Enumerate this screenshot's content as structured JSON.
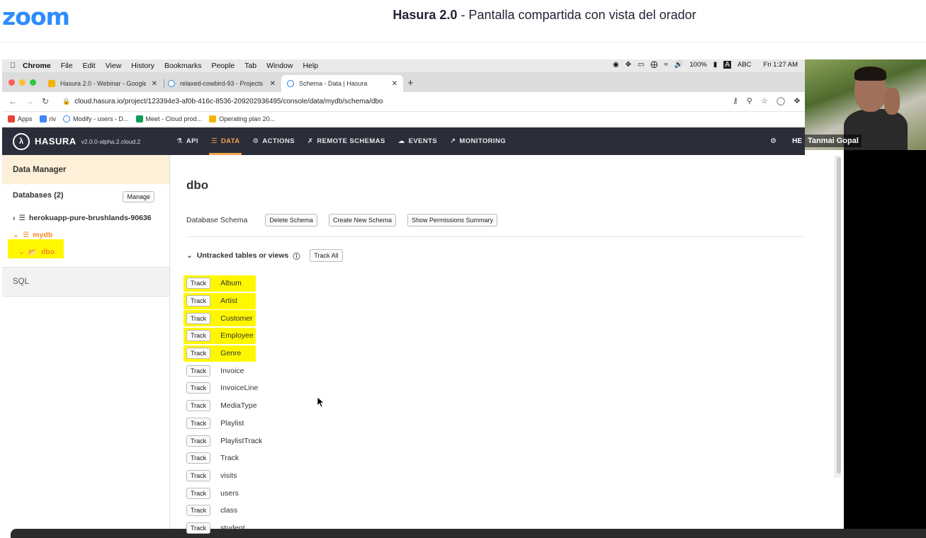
{
  "zoom": {
    "logo": "zoom",
    "title_bold": "Hasura 2.0",
    "title_rest": " - Pantalla compartida con vista del orador"
  },
  "mac": {
    "menu": [
      "Chrome",
      "File",
      "Edit",
      "View",
      "History",
      "Bookmarks",
      "People",
      "Tab",
      "Window",
      "Help"
    ],
    "battery": "100%",
    "input": "ABC",
    "clock": "Fri 1:27 AM"
  },
  "tabs": [
    {
      "title": "Hasura 2.0 - Webinar - Google",
      "favicon_color": "#f4b400"
    },
    {
      "title": "relaxed-cowbird-93 - Projects",
      "favicon_color": "#1e88e5"
    },
    {
      "title": "Schema - Data | Hasura",
      "favicon_color": "#1e88e5",
      "active": true
    }
  ],
  "address": {
    "url": "cloud.hasura.io/project/123394e3-af0b-416c-8536-209202936495/console/data/mydb/schema/dbo"
  },
  "bookmarks": [
    {
      "label": "Apps",
      "color": "#e94235"
    },
    {
      "label": "riv",
      "color": "#4285f4"
    },
    {
      "label": "Modify - users - D...",
      "color": "#1e88e5"
    },
    {
      "label": "Meet - Cloud prod...",
      "color": "#0f9d58"
    },
    {
      "label": "Operating plan 20...",
      "color": "#f4b400"
    }
  ],
  "hasura": {
    "brand": "HASURA",
    "version": "v2.0.0-alpha.2.cloud.2",
    "nav": [
      {
        "label": "API",
        "icon": "flask-icon"
      },
      {
        "label": "DATA",
        "icon": "database-icon",
        "active": true
      },
      {
        "label": "ACTIONS",
        "icon": "gears-icon"
      },
      {
        "label": "REMOTE SCHEMAS",
        "icon": "plug-icon"
      },
      {
        "label": "EVENTS",
        "icon": "cloud-icon"
      },
      {
        "label": "MONITORING",
        "icon": "chart-icon"
      }
    ],
    "nav_right_label": "HE",
    "accent": "#f6a54b"
  },
  "sidebar": {
    "header": "Data Manager",
    "databases_label": "Databases (2)",
    "manage_label": "Manage",
    "db1": "herokuapp-pure-brushlands-90636",
    "db2": "mydb",
    "schema": "dbo",
    "sql": "SQL"
  },
  "main": {
    "title": "dbo",
    "db_schema_label": "Database Schema",
    "delete_schema": "Delete Schema",
    "create_schema": "Create New Schema",
    "show_permissions": "Show Permissions Summary",
    "untracked_label": "Untracked tables or views",
    "track_all": "Track All",
    "track_label": "Track",
    "tables": [
      {
        "name": "Album",
        "highlighted": true
      },
      {
        "name": "Artist",
        "highlighted": true
      },
      {
        "name": "Customer",
        "highlighted": true
      },
      {
        "name": "Employee",
        "highlighted": true
      },
      {
        "name": "Genre",
        "highlighted": true
      },
      {
        "name": "Invoice",
        "highlighted": false
      },
      {
        "name": "InvoiceLine",
        "highlighted": false
      },
      {
        "name": "MediaType",
        "highlighted": false
      },
      {
        "name": "Playlist",
        "highlighted": false
      },
      {
        "name": "PlaylistTrack",
        "highlighted": false
      },
      {
        "name": "Track",
        "highlighted": false
      },
      {
        "name": "visits",
        "highlighted": false
      },
      {
        "name": "users",
        "highlighted": false
      },
      {
        "name": "class",
        "highlighted": false
      },
      {
        "name": "student",
        "highlighted": false
      }
    ]
  },
  "participant": {
    "name": "Tanmai Gopal"
  }
}
